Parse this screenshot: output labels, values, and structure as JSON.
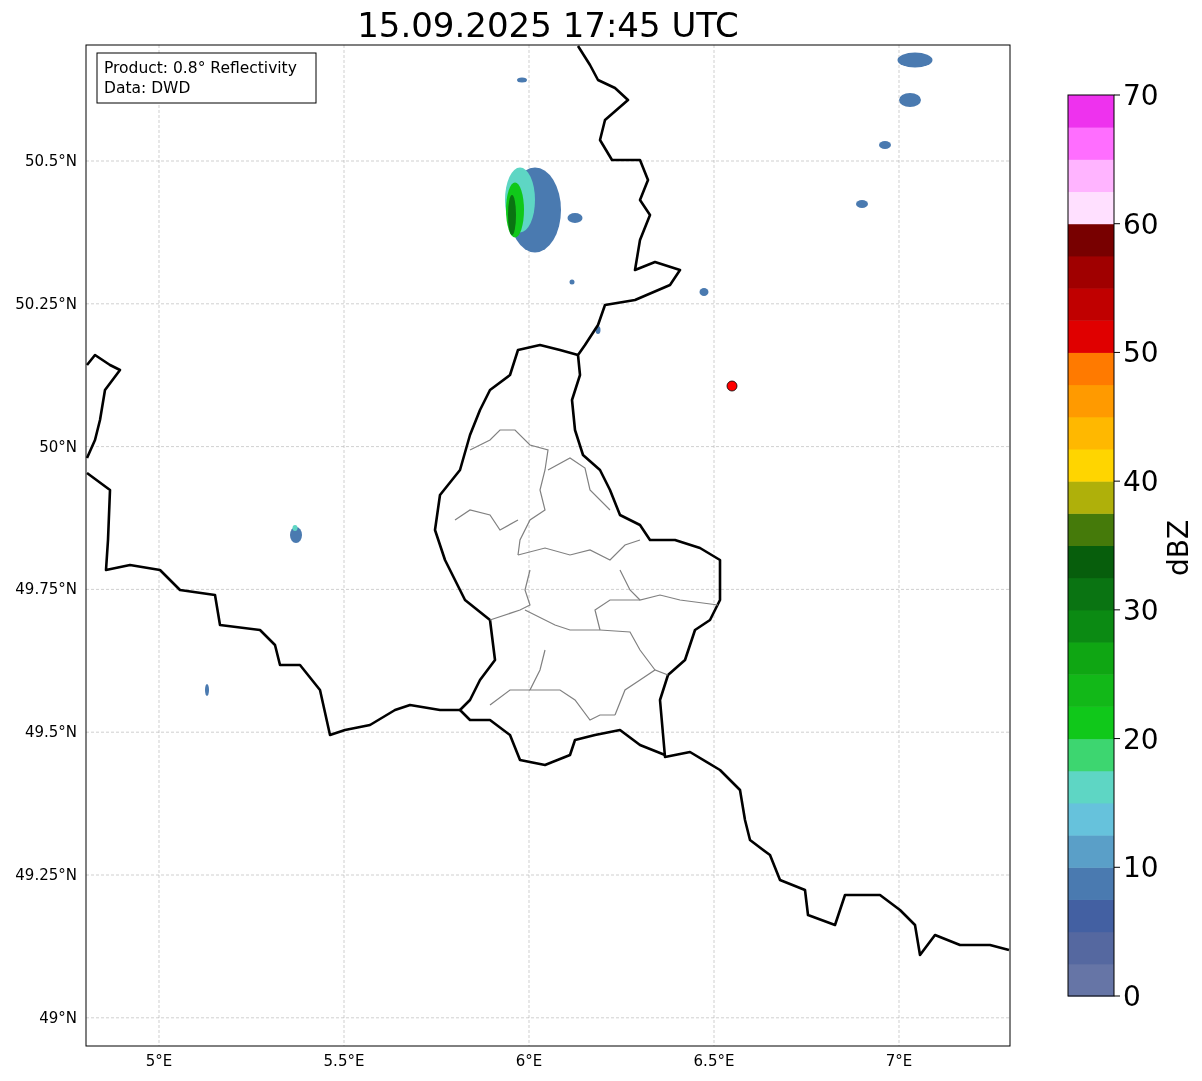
{
  "title": "15.09.2025 17:45 UTC",
  "info_box": [
    "Product: 0.8° Reflectivity",
    "Data: DWD"
  ],
  "map": {
    "x_ticks": [
      "5°E",
      "5.5°E",
      "6°E",
      "6.5°E",
      "7°E"
    ],
    "y_ticks": [
      "50.5°N",
      "50.25°N",
      "50°N",
      "49.75°N",
      "49.5°N",
      "49.25°N",
      "49°N"
    ]
  },
  "colorbar": {
    "label": "dBZ",
    "ticks": [
      "70",
      "60",
      "50",
      "40",
      "30",
      "20",
      "10",
      "0"
    ],
    "levels": [
      {
        "color": "#6675a6"
      },
      {
        "color": "#5568a0"
      },
      {
        "color": "#4360a2"
      },
      {
        "color": "#4a7ab0"
      },
      {
        "color": "#5a9fc8"
      },
      {
        "color": "#66c2dc"
      },
      {
        "color": "#5ed6c4"
      },
      {
        "color": "#3dd670"
      },
      {
        "color": "#10c81a"
      },
      {
        "color": "#12b818"
      },
      {
        "color": "#0fa613"
      },
      {
        "color": "#0b8a13"
      },
      {
        "color": "#0a7412"
      },
      {
        "color": "#075e0c"
      },
      {
        "color": "#457a0a"
      },
      {
        "color": "#afb00a"
      },
      {
        "color": "#ffd500"
      },
      {
        "color": "#ffb800"
      },
      {
        "color": "#ff9a00"
      },
      {
        "color": "#ff7a00"
      },
      {
        "color": "#e00000"
      },
      {
        "color": "#c00000"
      },
      {
        "color": "#a00000"
      },
      {
        "color": "#780000"
      },
      {
        "color": "#ffe0ff"
      },
      {
        "color": "#ffb4ff"
      },
      {
        "color": "#ff6eff"
      },
      {
        "color": "#ee32ee"
      }
    ]
  }
}
